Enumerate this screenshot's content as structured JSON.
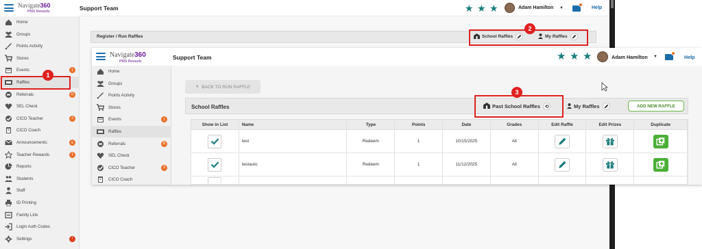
{
  "brand": {
    "name_main": "Navigate",
    "name_num": "360",
    "sub": "PBIS Rewards"
  },
  "header": {
    "team": "Support Team",
    "user": "Adam Hamilton",
    "help": "Help",
    "mail_badge": ""
  },
  "sidebar": {
    "items": [
      {
        "label": "Home",
        "icon": "home-icon"
      },
      {
        "label": "Groups",
        "icon": "groups-icon"
      },
      {
        "label": "Points Activity",
        "icon": "rocket-icon"
      },
      {
        "label": "Stores",
        "icon": "cart-icon"
      },
      {
        "label": "Events",
        "icon": "calendar-icon",
        "badge": "1"
      },
      {
        "label": "Raffles",
        "icon": "ticket-icon"
      },
      {
        "label": "Referrals",
        "icon": "referral-icon",
        "badge": "11"
      },
      {
        "label": "SEL Check",
        "icon": "heart-icon"
      },
      {
        "label": "CICO Teacher",
        "icon": "check-circle-icon",
        "badge": "3"
      },
      {
        "label": "CICO Coach",
        "icon": "clipboard-icon"
      },
      {
        "label": "Announcements",
        "icon": "envelope-icon",
        "badge": "6"
      },
      {
        "label": "Teacher Rewards",
        "icon": "star-icon",
        "badge": "1"
      },
      {
        "label": "Reports",
        "icon": "pie-chart-icon"
      },
      {
        "label": "Students",
        "icon": "students-icon"
      },
      {
        "label": "Staff",
        "icon": "person-icon"
      },
      {
        "label": "ID Printing",
        "icon": "printer-icon"
      },
      {
        "label": "Family Link",
        "icon": "link-icon"
      },
      {
        "label": "Login Auth Codes",
        "icon": "login-icon"
      },
      {
        "label": "Settings",
        "icon": "gear-icon",
        "badge": "!"
      }
    ]
  },
  "bg_panel": {
    "title": "Register / Run Raffles",
    "school_raffles": "School Raffles",
    "my_raffles": "My Raffles"
  },
  "overlay": {
    "back": "BACK TO RUN RAFFLE",
    "title": "School Raffles",
    "past": "Past School Raffles",
    "my_raffles": "My Raffles",
    "add": "ADD NEW RAFFLE",
    "columns": [
      "Show in List",
      "Name",
      "Type",
      "Points",
      "Date",
      "Grades",
      "Edit Raffle",
      "Edit Prizes",
      "Duplicate"
    ],
    "rows": [
      {
        "name": "test",
        "type": "Redeem",
        "points": "1",
        "date": "10/15/2025",
        "grades": "All"
      },
      {
        "name": "testauto",
        "type": "Redeem",
        "points": "1",
        "date": "11/12/2025",
        "grades": "All"
      }
    ]
  },
  "annotations": [
    "1",
    "2",
    "3"
  ],
  "colors": {
    "teal": "#1b7d7d",
    "blue": "#1b6ca8",
    "purple": "#6a1b9a",
    "orange": "#e8702a",
    "green": "#4caf38",
    "red": "#e02020"
  }
}
